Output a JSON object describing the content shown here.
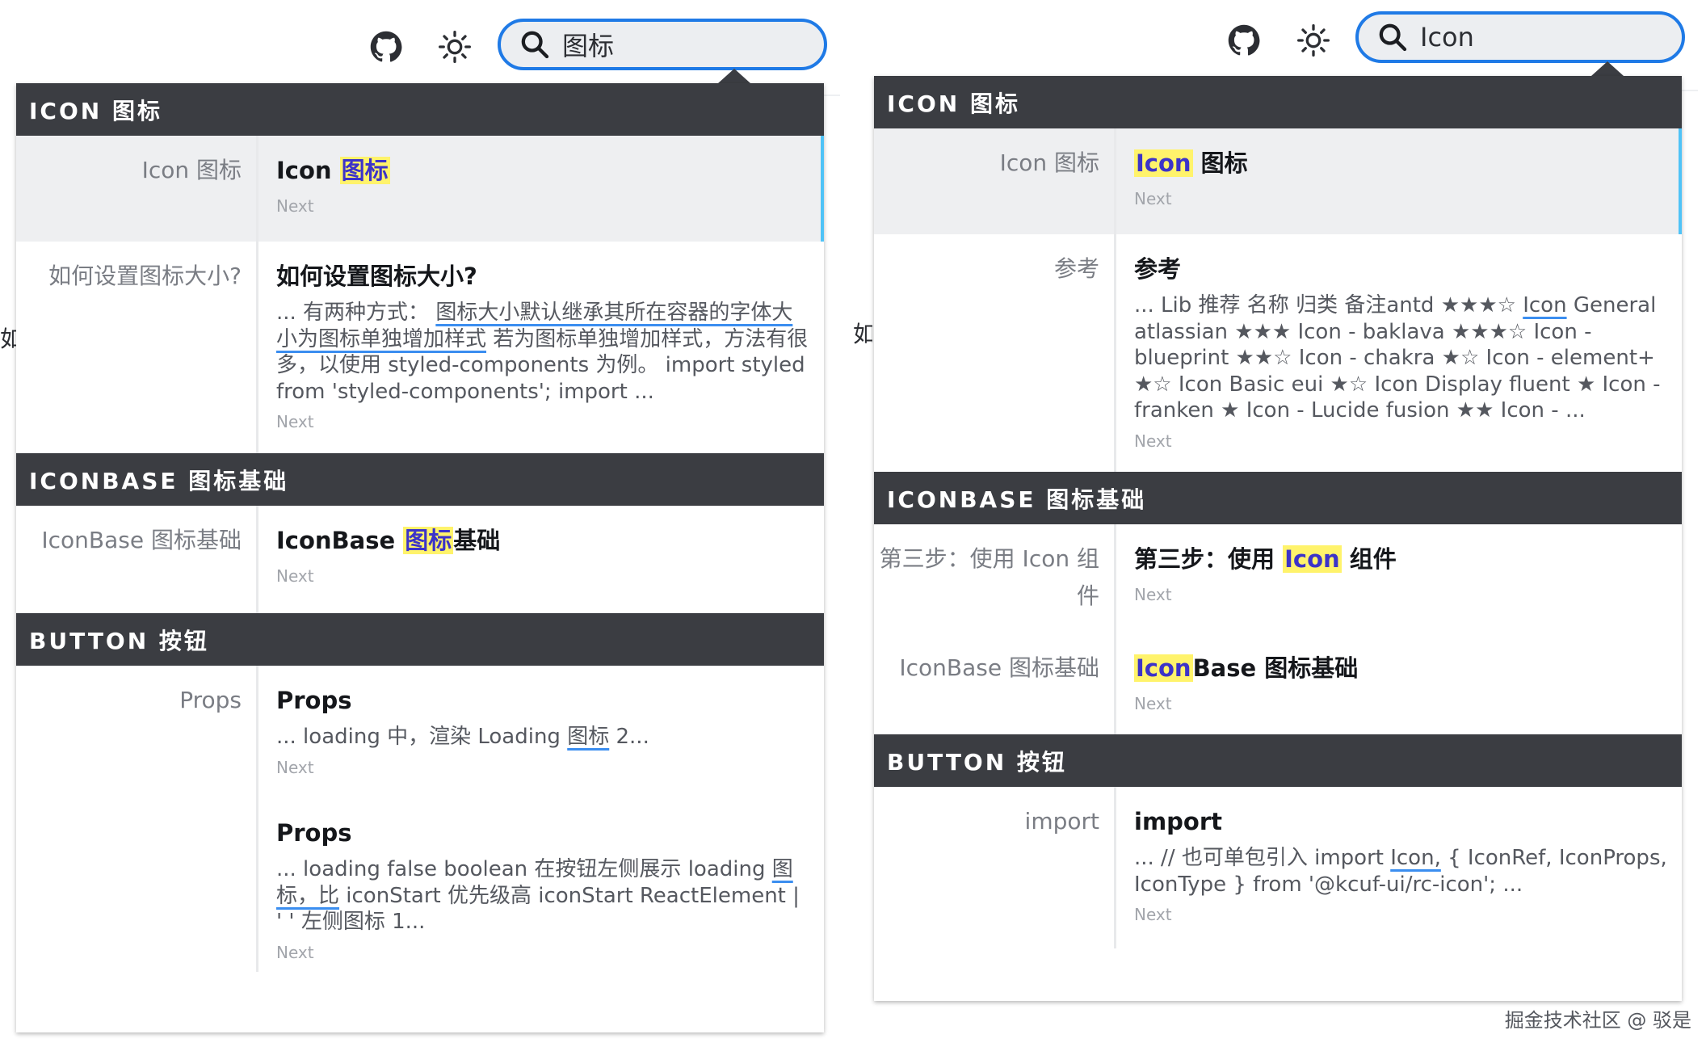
{
  "left_pane": {
    "search": {
      "value": "图标"
    },
    "sliver_text": "如",
    "sections": [
      {
        "header": "ICON 图标",
        "hits": [
          {
            "left": "Icon 图标",
            "title_pre": "Icon ",
            "title_mark": "图标",
            "title_post": "",
            "next": "Next"
          },
          {
            "left": "如何设置图标大小?",
            "title": "如何设置图标大小?",
            "text_pre": "... 有两种方式： ",
            "text_ul": "图标大小默认继承其所在容器的字体大小为图标单独增加样式",
            "text_post": " 若为图标单独增加样式，方法有很多，以使用 styled-components 为例。 import styled from 'styled-components'; import ...",
            "next": "Next"
          }
        ]
      },
      {
        "header": "ICONBASE 图标基础",
        "hits": [
          {
            "left": "IconBase 图标基础",
            "title_pre": "IconBase ",
            "title_mark": "图标",
            "title_post": "基础",
            "next": "Next"
          }
        ]
      },
      {
        "header": "BUTTON 按钮",
        "hits": [
          {
            "left": "Props",
            "title": "Props",
            "text_pre": "... loading 中，渲染 Loading ",
            "text_ul": "图标",
            "text_post": " 2...",
            "next": "Next"
          },
          {
            "left": "",
            "title": "Props",
            "text_pre": "... loading false boolean 在按钮左侧展示 loading ",
            "text_ul": "图标，比",
            "text_post": " iconStart 优先级高 iconStart ReactElement | ' ' 左侧图标 1...",
            "next": "Next"
          }
        ]
      }
    ]
  },
  "right_pane": {
    "search": {
      "value": "Icon"
    },
    "sliver_text": "如",
    "sections": [
      {
        "header": "ICON 图标",
        "hits": [
          {
            "left": "Icon 图标",
            "title_pre": "",
            "title_mark": "Icon",
            "title_post": " 图标",
            "next": "Next"
          },
          {
            "left": "参考",
            "title": "参考",
            "text_pre": "... Lib 推荐 名称 归类 备注antd ★★★☆ ",
            "text_ul": "Icon",
            "text_post": " General atlassian ★★★ Icon - baklava ★★★☆ Icon - blueprint ★★☆ Icon - chakra ★☆ Icon - element+ ★☆ Icon Basic eui ★☆ Icon Display fluent ★ Icon - franken ★ Icon - Lucide fusion ★★ Icon - ...",
            "next": "Next"
          }
        ]
      },
      {
        "header": "ICONBASE 图标基础",
        "hits": [
          {
            "left": "第三步：使用 Icon 组件",
            "title_pre": "第三步：使用 ",
            "title_mark": "Icon",
            "title_post": " 组件",
            "next": "Next"
          },
          {
            "left": "IconBase 图标基础",
            "title_pre": "",
            "title_mark": "Icon",
            "title_post": "Base 图标基础",
            "next": "Next"
          }
        ]
      },
      {
        "header": "BUTTON 按钮",
        "hits": [
          {
            "left": "import",
            "title": "import",
            "text_pre": "... // 也可单包引入 import ",
            "text_ul": "Icon,",
            "text_post": " { IconRef, IconProps, IconType } from '@kcuf-ui/rc-icon'; ...",
            "next": "Next"
          }
        ]
      }
    ]
  },
  "watermark": "掘金技术社区 @ 驳是",
  "icons": [
    "github-icon",
    "sun-icon",
    "search-icon"
  ],
  "colors": {
    "accent": "#1f7ae6",
    "header_bg": "#3b3d42",
    "highlight": "#fff36b",
    "highlight_text": "#3c33c9",
    "active_bar": "#4fc3f7"
  }
}
